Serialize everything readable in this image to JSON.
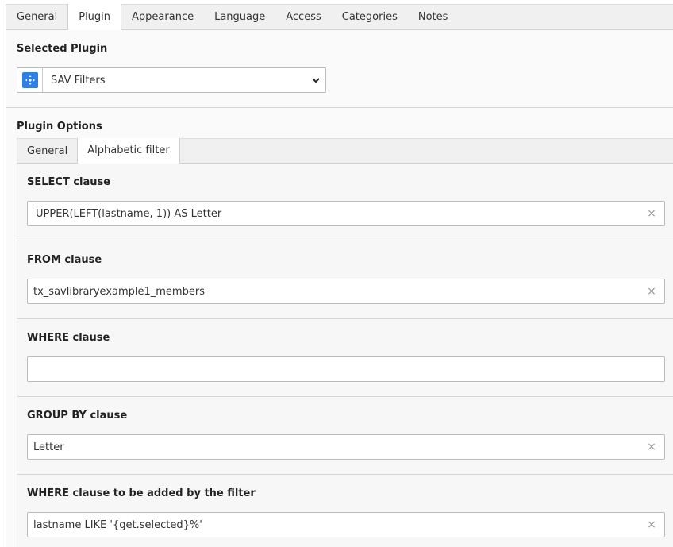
{
  "top_tabs": [
    "General",
    "Plugin",
    "Appearance",
    "Language",
    "Access",
    "Categories",
    "Notes"
  ],
  "top_tab_active": "Plugin",
  "selected_plugin": {
    "label": "Selected Plugin",
    "value": "SAV Filters",
    "icon": "plugin-extension-icon"
  },
  "plugin_options": {
    "label": "Plugin Options",
    "tabs": [
      "General",
      "Alphabetic filter"
    ],
    "active_tab": "Alphabetic filter"
  },
  "fields": [
    {
      "label": "SELECT clause",
      "value": "UPPER(LEFT(lastname, 1)) AS Letter",
      "clearable": true
    },
    {
      "label": "FROM clause",
      "value": "tx_savlibraryexample1_members",
      "clearable": true
    },
    {
      "label": "WHERE clause",
      "value": "",
      "clearable": false
    },
    {
      "label": "GROUP BY clause",
      "value": "Letter",
      "clearable": true
    },
    {
      "label": "WHERE clause to be added by the filter",
      "value": "lastname LIKE  '{get.selected}%'",
      "clearable": true
    }
  ],
  "clear_glyph": "×",
  "colors": {
    "accent": "#2c80e6",
    "panel": "#fafafa",
    "border": "#bbbbbb"
  }
}
